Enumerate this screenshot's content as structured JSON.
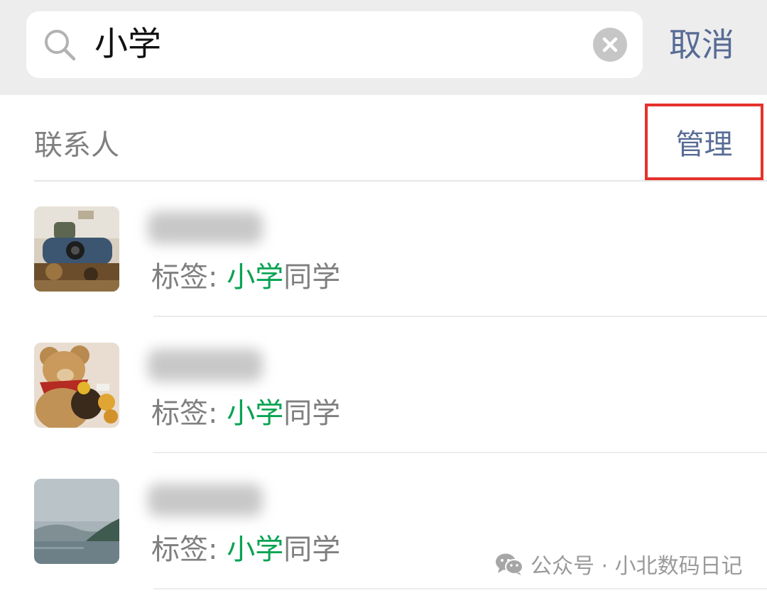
{
  "search": {
    "query": "小学",
    "cancel_label": "取消"
  },
  "contacts_section": {
    "title": "联系人",
    "manage_label": "管理",
    "manage_highlight_color": "#e5312b"
  },
  "results": [
    {
      "tag_label": "标签: ",
      "tag_match": "小学",
      "tag_rest": "同学",
      "avatar": "person-with-camera"
    },
    {
      "tag_label": "标签: ",
      "tag_match": "小学",
      "tag_rest": "同学",
      "avatar": "teddy-bear"
    },
    {
      "tag_label": "标签: ",
      "tag_match": "小学",
      "tag_rest": "同学",
      "avatar": "misty-lake"
    }
  ],
  "watermark": {
    "text": "公众号 · 小北数码日记"
  },
  "colors": {
    "link_blue": "#576b95",
    "match_green": "#07a352",
    "search_bar_bg": "#ededed"
  }
}
